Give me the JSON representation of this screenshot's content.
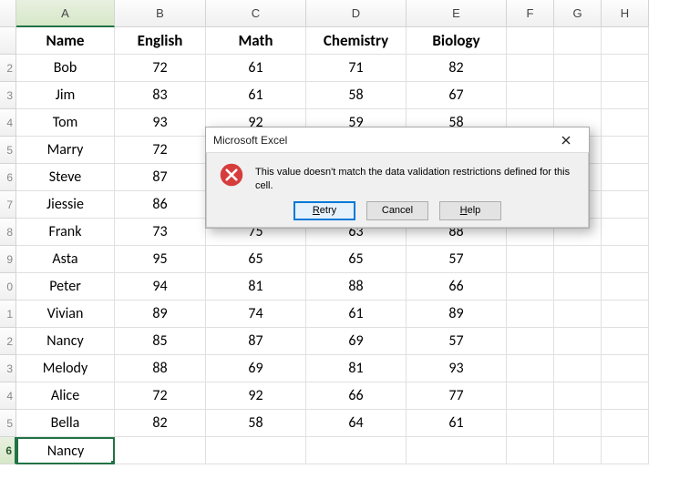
{
  "columns": [
    "A",
    "B",
    "C",
    "D",
    "E",
    "F",
    "G",
    "H"
  ],
  "rowNumbers": [
    "",
    "2",
    "3",
    "4",
    "5",
    "6",
    "7",
    "8",
    "9",
    "0",
    "1",
    "2",
    "3",
    "4",
    "5",
    "6"
  ],
  "headers": {
    "name": "Name",
    "english": "English",
    "math": "Math",
    "chemistry": "Chemistry",
    "biology": "Biology"
  },
  "rows": [
    {
      "name": "Bob",
      "english": "72",
      "math": "61",
      "chemistry": "71",
      "biology": "82"
    },
    {
      "name": "Jim",
      "english": "83",
      "math": "61",
      "chemistry": "58",
      "biology": "67"
    },
    {
      "name": "Tom",
      "english": "93",
      "math": "92",
      "chemistry": "59",
      "biology": "58"
    },
    {
      "name": "Marry",
      "english": "72",
      "math": "",
      "chemistry": "",
      "biology": ""
    },
    {
      "name": "Steve",
      "english": "87",
      "math": "",
      "chemistry": "",
      "biology": ""
    },
    {
      "name": "Jiessie",
      "english": "86",
      "math": "",
      "chemistry": "",
      "biology": ""
    },
    {
      "name": "Frank",
      "english": "73",
      "math": "75",
      "chemistry": "63",
      "biology": "88"
    },
    {
      "name": "Asta",
      "english": "95",
      "math": "65",
      "chemistry": "65",
      "biology": "57"
    },
    {
      "name": "Peter",
      "english": "94",
      "math": "81",
      "chemistry": "88",
      "biology": "66"
    },
    {
      "name": "Vivian",
      "english": "89",
      "math": "74",
      "chemistry": "61",
      "biology": "89"
    },
    {
      "name": "Nancy",
      "english": "85",
      "math": "87",
      "chemistry": "69",
      "biology": "57"
    },
    {
      "name": "Melody",
      "english": "88",
      "math": "69",
      "chemistry": "81",
      "biology": "93"
    },
    {
      "name": "Alice",
      "english": "72",
      "math": "92",
      "chemistry": "66",
      "biology": "77"
    },
    {
      "name": "Bella",
      "english": "82",
      "math": "58",
      "chemistry": "64",
      "biology": "61"
    }
  ],
  "activeCell": {
    "value": "Nancy"
  },
  "dialog": {
    "title": "Microsoft Excel",
    "message": "This value doesn't match the data validation restrictions defined for this cell.",
    "buttons": {
      "retry": "Retry",
      "cancel": "Cancel",
      "help": "Help"
    }
  }
}
